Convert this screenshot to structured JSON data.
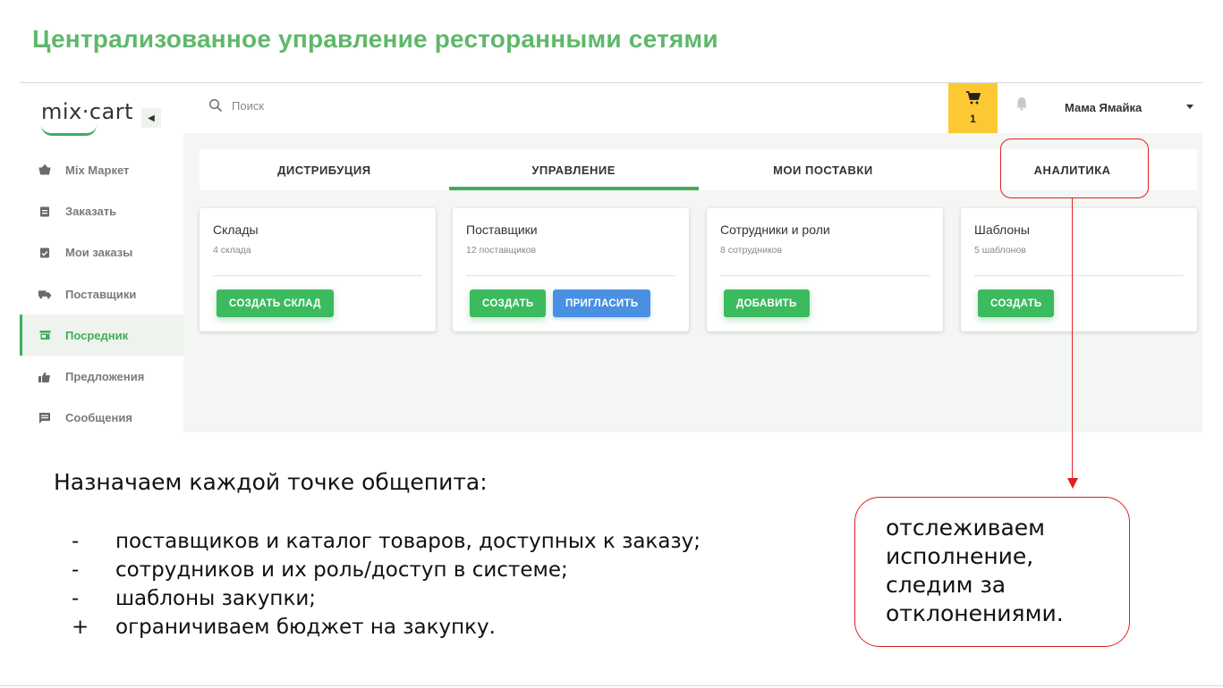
{
  "slide": {
    "title": "Централизованное управление ресторанными сетями"
  },
  "sidebar": {
    "logo_text": "mix·cart",
    "items": [
      {
        "label": "Mix Маркет",
        "icon": "basket-icon"
      },
      {
        "label": "Заказать",
        "icon": "clipboard-icon"
      },
      {
        "label": "Мои заказы",
        "icon": "clipboard-check-icon"
      },
      {
        "label": "Поставщики",
        "icon": "truck-icon"
      },
      {
        "label": "Посредник",
        "icon": "store-icon",
        "active": true
      },
      {
        "label": "Предложения",
        "icon": "thumb-up-icon"
      },
      {
        "label": "Сообщения",
        "icon": "message-icon"
      }
    ]
  },
  "topbar": {
    "search_placeholder": "Поиск",
    "cart_count": "1",
    "user_name": "Мама Ямайка"
  },
  "tabs": [
    {
      "label": "ДИСТРИБУЦИЯ"
    },
    {
      "label": "УПРАВЛЕНИЕ",
      "active": true
    },
    {
      "label": "МОИ ПОСТАВКИ"
    },
    {
      "label": "АНАЛИТИКА"
    }
  ],
  "cards": [
    {
      "title": "Склады",
      "subtitle": "4 склада",
      "buttons": [
        {
          "label": "СОЗДАТЬ СКЛАД",
          "color": "green"
        }
      ]
    },
    {
      "title": "Поставщики",
      "subtitle": "12 поставщиков",
      "buttons": [
        {
          "label": "СОЗДАТЬ",
          "color": "green"
        },
        {
          "label": "ПРИГЛАСИТЬ",
          "color": "blue"
        }
      ]
    },
    {
      "title": "Сотрудники и роли",
      "subtitle": "8 сотрудников",
      "buttons": [
        {
          "label": "ДОБАВИТЬ",
          "color": "green"
        }
      ]
    },
    {
      "title": "Шаблоны",
      "subtitle": "5 шаблонов",
      "buttons": [
        {
          "label": "СОЗДАТЬ",
          "color": "green"
        }
      ]
    }
  ],
  "annotation": {
    "lines": [
      "отслеживаем",
      "исполнение,",
      "следим за",
      "отклонениями."
    ]
  },
  "description": {
    "heading": "Назначаем каждой точке общепита:",
    "items": [
      {
        "marker": "-",
        "text": "поставщиков и каталог товаров, доступных к заказу;"
      },
      {
        "marker": "-",
        "text": "сотрудников и их роль/доступ в системе;"
      },
      {
        "marker": "-",
        "text": "шаблоны закупки;"
      },
      {
        "marker": "+",
        "text": "ограничиваем бюджет на закупку."
      }
    ]
  },
  "colors": {
    "accent_green": "#3fae5a",
    "title_green": "#5fb86a",
    "cart_yellow": "#fcc934",
    "invite_blue": "#4a90e2",
    "annotation_red": "#e02020"
  }
}
